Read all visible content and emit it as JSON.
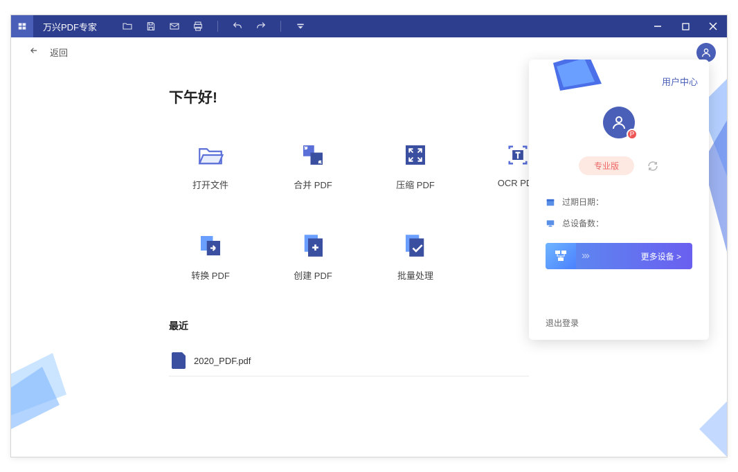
{
  "titlebar": {
    "app": "万兴PDF专家"
  },
  "backbar": {
    "label": "返回"
  },
  "greeting": "下午好!",
  "tiles": [
    {
      "label": "打开文件"
    },
    {
      "label": "合并 PDF"
    },
    {
      "label": "压缩 PDF"
    },
    {
      "label": "OCR PDF"
    },
    {
      "label": "转换 PDF"
    },
    {
      "label": "创建 PDF"
    },
    {
      "label": "批量处理"
    }
  ],
  "recent": {
    "heading": "最近",
    "items": [
      {
        "name": "2020_PDF.pdf"
      }
    ]
  },
  "panel": {
    "title": "用户中心",
    "badge": "P",
    "plan": "专业版",
    "expiry_label": "过期日期：",
    "devices_label": "总设备数：",
    "more_devices": "更多设备 >",
    "logout": "退出登录"
  }
}
